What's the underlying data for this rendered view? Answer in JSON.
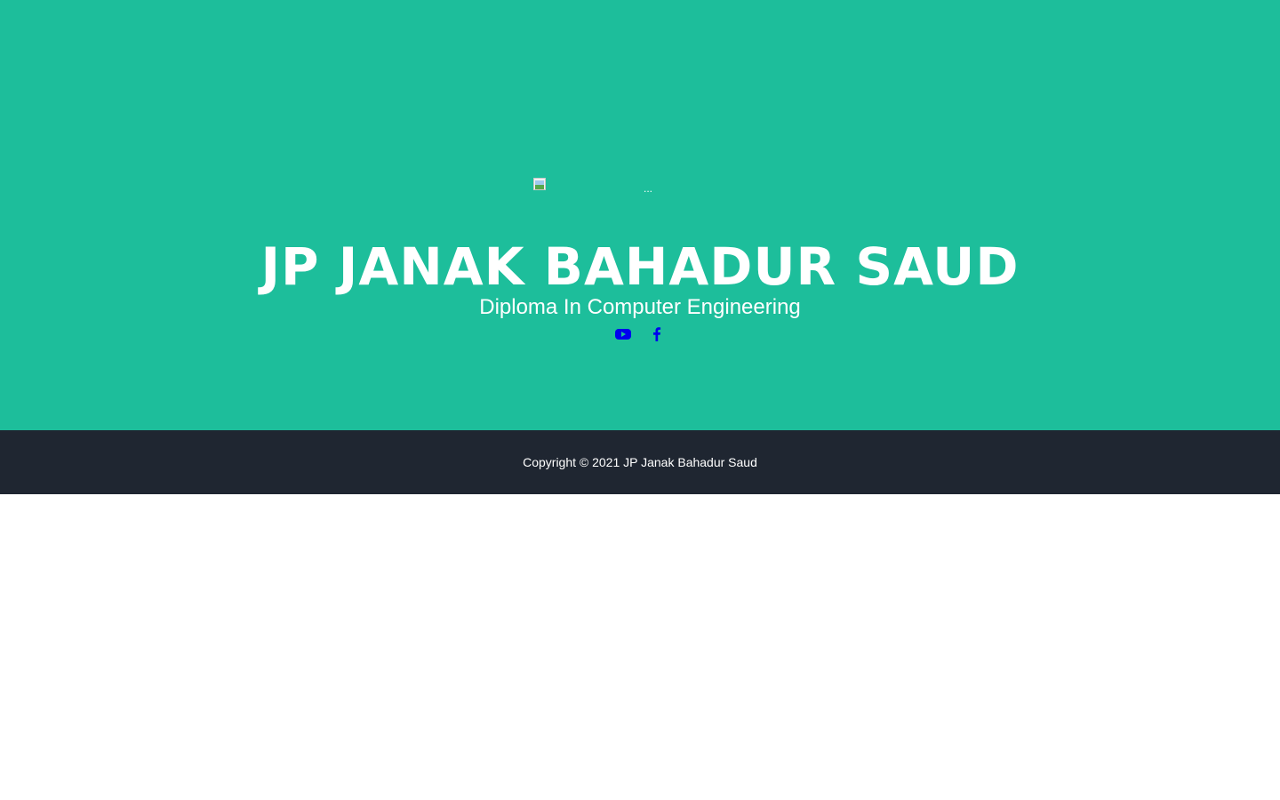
{
  "masthead": {
    "avatar_alt": "...",
    "name": "JP JANAK BAHADUR SAUD",
    "tagline": "Diploma In Computer Engineering",
    "social": [
      {
        "icon": "youtube-icon",
        "label": "YouTube"
      },
      {
        "icon": "facebook-icon",
        "label": "Facebook"
      }
    ]
  },
  "footer": {
    "copyright": "Copyright © 2021 JP Janak Bahadur Saud"
  },
  "colors": {
    "masthead_bg": "#1dbe9b",
    "footer_bg": "#1f2631",
    "text": "#ffffff",
    "link": "#0000ee"
  }
}
